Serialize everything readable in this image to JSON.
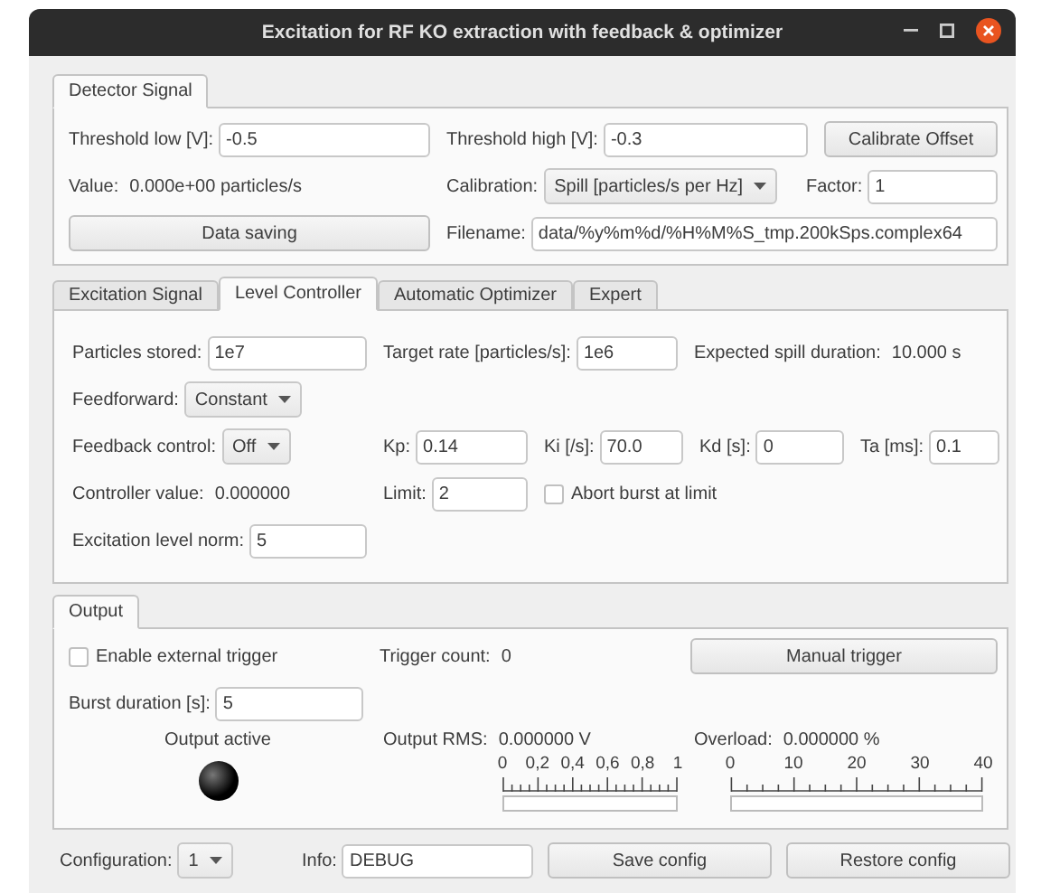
{
  "window": {
    "title": "Excitation for RF KO extraction with feedback & optimizer"
  },
  "detector": {
    "tab": "Detector Signal",
    "rows": [
      [
        {
          "kind": "field",
          "label": "Threshold low [V]:",
          "value": "-0.5"
        },
        {
          "kind": "field",
          "label": "Threshold high [V]:",
          "value": "-0.3"
        },
        {
          "kind": "button",
          "label": "Calibrate Offset"
        }
      ],
      [
        {
          "kind": "text",
          "label": "Value:",
          "value": "0.000e+00 particles/s"
        },
        {
          "kind": "select",
          "label": "Calibration:",
          "value": "Spill [particles/s per Hz]"
        },
        {
          "kind": "field",
          "label": "Factor:",
          "value": "1"
        }
      ],
      [
        {
          "kind": "button",
          "label": "Data saving"
        },
        {
          "kind": "field",
          "label": "Filename:",
          "value": "data/%y%m%d/%H%M%S_tmp.200kSps.complex64"
        }
      ]
    ]
  },
  "controller": {
    "tabs": [
      {
        "label": "Excitation Signal",
        "selected": false
      },
      {
        "label": "Level Controller",
        "selected": true
      },
      {
        "label": "Automatic Optimizer",
        "selected": false
      },
      {
        "label": "Expert",
        "selected": false
      }
    ],
    "rows": [
      [
        {
          "kind": "field",
          "label": "Particles stored:",
          "value": "1e7"
        },
        {
          "kind": "field",
          "label": "Target rate [particles/s]:",
          "value": "1e6"
        },
        {
          "kind": "text",
          "label": "Expected spill duration:",
          "value": "10.000 s"
        }
      ],
      [
        {
          "kind": "select",
          "label": "Feedforward:",
          "value": "Constant"
        }
      ],
      [
        {
          "kind": "select",
          "label": "Feedback control:",
          "value": "Off"
        },
        {
          "kind": "field",
          "label": "Kp:",
          "value": "0.14"
        },
        {
          "kind": "field",
          "label": "Ki [/s]:",
          "value": "70.0"
        },
        {
          "kind": "field",
          "label": "Kd [s]:",
          "value": "0"
        },
        {
          "kind": "field",
          "label": "Ta [ms]:",
          "value": "0.1"
        }
      ],
      [
        {
          "kind": "text",
          "label": "Controller value:",
          "value": "0.000000"
        },
        {
          "kind": "field",
          "label": "Limit:",
          "value": "2"
        },
        {
          "kind": "checkbox",
          "label": "Abort burst at limit",
          "checked": false
        }
      ],
      [
        {
          "kind": "field",
          "label": "Excitation level norm:",
          "value": "5"
        }
      ]
    ]
  },
  "output": {
    "tab": "Output",
    "rows": [
      [
        {
          "kind": "checkbox",
          "label": "Enable external trigger",
          "checked": false
        },
        {
          "kind": "text",
          "label": "Trigger count:",
          "value": "0"
        },
        {
          "kind": "button",
          "label": "Manual trigger"
        }
      ],
      [
        {
          "kind": "field",
          "label": "Burst duration [s]:",
          "value": "5"
        }
      ]
    ],
    "indicator": {
      "label": "Output active",
      "on": false
    },
    "meters": [
      {
        "label": "Output RMS:",
        "value": "0.000000 V",
        "ticks": [
          "0",
          "0,2",
          "0,4",
          "0,6",
          "0,8",
          "1"
        ]
      },
      {
        "label": "Overload:",
        "value": "0.000000 %",
        "ticks": [
          "0",
          "10",
          "20",
          "30",
          "40"
        ]
      }
    ]
  },
  "footer": [
    {
      "kind": "select",
      "label": "Configuration:",
      "value": "1"
    },
    {
      "kind": "field",
      "label": "Info:",
      "value": "DEBUG"
    },
    {
      "kind": "button",
      "label": "Save config"
    },
    {
      "kind": "button",
      "label": "Restore config"
    }
  ]
}
